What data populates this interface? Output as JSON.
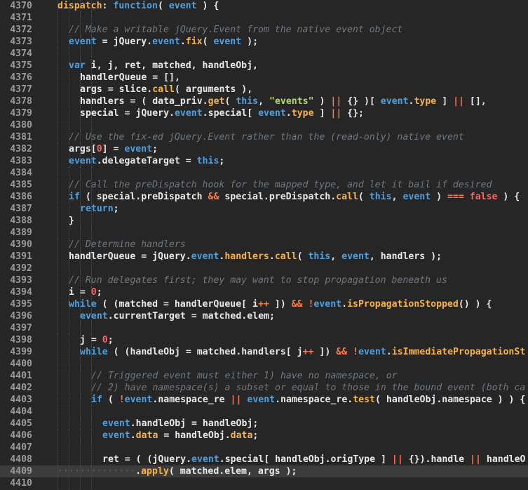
{
  "editor": {
    "active_line": 4409,
    "colors": {
      "background": "#262626",
      "active_line": "#3c3c3c",
      "keyword": "#4fa0e0",
      "function": "#f6b347",
      "comment": "#6f7880",
      "string": "#b5d96a",
      "number": "#ff6060",
      "operator": "#ff7a4a"
    },
    "lines": [
      {
        "n": "4370",
        "indent": 0,
        "tokens": [
          [
            "fn",
            "dispatch"
          ],
          [
            "pl",
            ": "
          ],
          [
            "kw",
            "function"
          ],
          [
            "pl",
            "( "
          ],
          [
            "kw",
            "event"
          ],
          [
            "pl",
            " ) {"
          ]
        ]
      },
      {
        "n": "4371",
        "indent": 0,
        "tokens": []
      },
      {
        "n": "4372",
        "indent": 1,
        "tokens": [
          [
            "cm",
            "// Make a writable jQuery.Event from the native event object"
          ]
        ]
      },
      {
        "n": "4373",
        "indent": 1,
        "tokens": [
          [
            "kw",
            "event"
          ],
          [
            "pl",
            " = jQuery."
          ],
          [
            "kw",
            "event"
          ],
          [
            "pl",
            "."
          ],
          [
            "fn",
            "fix"
          ],
          [
            "pl",
            "( "
          ],
          [
            "kw",
            "event"
          ],
          [
            "pl",
            " );"
          ]
        ]
      },
      {
        "n": "4374",
        "indent": 0,
        "tokens": []
      },
      {
        "n": "4375",
        "indent": 1,
        "tokens": [
          [
            "kw",
            "var"
          ],
          [
            "pl",
            " i, j, ret, matched, handleObj,"
          ]
        ]
      },
      {
        "n": "4376",
        "indent": 2,
        "tokens": [
          [
            "pl",
            "handlerQueue = [],"
          ]
        ]
      },
      {
        "n": "4377",
        "indent": 2,
        "tokens": [
          [
            "pl",
            "args = slice."
          ],
          [
            "fn",
            "call"
          ],
          [
            "pl",
            "( arguments ),"
          ]
        ]
      },
      {
        "n": "4378",
        "indent": 2,
        "tokens": [
          [
            "pl",
            "handlers = ( data_priv."
          ],
          [
            "fn",
            "get"
          ],
          [
            "pl",
            "( "
          ],
          [
            "kw",
            "this"
          ],
          [
            "pl",
            ", "
          ],
          [
            "str",
            "\"events\""
          ],
          [
            "pl",
            " ) "
          ],
          [
            "op",
            "||"
          ],
          [
            "pl",
            " {} )[ "
          ],
          [
            "kw",
            "event"
          ],
          [
            "pl",
            "."
          ],
          [
            "prop",
            "type"
          ],
          [
            "pl",
            " ] "
          ],
          [
            "op",
            "||"
          ],
          [
            "pl",
            " [],"
          ]
        ]
      },
      {
        "n": "4379",
        "indent": 2,
        "tokens": [
          [
            "pl",
            "special = jQuery."
          ],
          [
            "kw",
            "event"
          ],
          [
            "pl",
            ".special[ "
          ],
          [
            "kw",
            "event"
          ],
          [
            "pl",
            "."
          ],
          [
            "prop",
            "type"
          ],
          [
            "pl",
            " ] "
          ],
          [
            "op",
            "||"
          ],
          [
            "pl",
            " {};"
          ]
        ]
      },
      {
        "n": "4380",
        "indent": 0,
        "tokens": []
      },
      {
        "n": "4381",
        "indent": 1,
        "tokens": [
          [
            "cm",
            "// Use the fix-ed jQuery.Event rather than the (read-only) native event"
          ]
        ]
      },
      {
        "n": "4382",
        "indent": 1,
        "tokens": [
          [
            "pl",
            "args["
          ],
          [
            "num",
            "0"
          ],
          [
            "pl",
            "] = "
          ],
          [
            "kw",
            "event"
          ],
          [
            "pl",
            ";"
          ]
        ]
      },
      {
        "n": "4383",
        "indent": 1,
        "tokens": [
          [
            "kw",
            "event"
          ],
          [
            "pl",
            ".delegateTarget = "
          ],
          [
            "kw",
            "this"
          ],
          [
            "pl",
            ";"
          ]
        ]
      },
      {
        "n": "4384",
        "indent": 0,
        "tokens": []
      },
      {
        "n": "4385",
        "indent": 1,
        "tokens": [
          [
            "cm",
            "// Call the preDispatch hook for the mapped type, and let it bail if desired"
          ]
        ]
      },
      {
        "n": "4386",
        "indent": 1,
        "tokens": [
          [
            "kw",
            "if"
          ],
          [
            "pl",
            " ( special.preDispatch "
          ],
          [
            "op",
            "&&"
          ],
          [
            "pl",
            " special.preDispatch."
          ],
          [
            "fn",
            "call"
          ],
          [
            "pl",
            "( "
          ],
          [
            "kw",
            "this"
          ],
          [
            "pl",
            ", "
          ],
          [
            "kw",
            "event"
          ],
          [
            "pl",
            " ) "
          ],
          [
            "op",
            "==="
          ],
          [
            "pl",
            " "
          ],
          [
            "num",
            "false"
          ],
          [
            "pl",
            " ) {"
          ]
        ]
      },
      {
        "n": "4387",
        "indent": 2,
        "tokens": [
          [
            "kw",
            "return"
          ],
          [
            "pl",
            ";"
          ]
        ]
      },
      {
        "n": "4388",
        "indent": 1,
        "tokens": [
          [
            "pl",
            "}"
          ]
        ]
      },
      {
        "n": "4389",
        "indent": 0,
        "tokens": []
      },
      {
        "n": "4390",
        "indent": 1,
        "tokens": [
          [
            "cm",
            "// Determine handlers"
          ]
        ]
      },
      {
        "n": "4391",
        "indent": 1,
        "tokens": [
          [
            "pl",
            "handlerQueue = jQuery."
          ],
          [
            "kw",
            "event"
          ],
          [
            "pl",
            "."
          ],
          [
            "fn",
            "handlers"
          ],
          [
            "pl",
            "."
          ],
          [
            "fn",
            "call"
          ],
          [
            "pl",
            "( "
          ],
          [
            "kw",
            "this"
          ],
          [
            "pl",
            ", "
          ],
          [
            "kw",
            "event"
          ],
          [
            "pl",
            ", handlers );"
          ]
        ]
      },
      {
        "n": "4392",
        "indent": 0,
        "tokens": []
      },
      {
        "n": "4393",
        "indent": 1,
        "tokens": [
          [
            "cm",
            "// Run delegates first; they may want to stop propagation beneath us"
          ]
        ]
      },
      {
        "n": "4394",
        "indent": 1,
        "tokens": [
          [
            "pl",
            "i = "
          ],
          [
            "num",
            "0"
          ],
          [
            "pl",
            ";"
          ]
        ]
      },
      {
        "n": "4395",
        "indent": 1,
        "tokens": [
          [
            "kw",
            "while"
          ],
          [
            "pl",
            " ( (matched = handlerQueue[ i"
          ],
          [
            "op",
            "++"
          ],
          [
            "pl",
            " ]) "
          ],
          [
            "op",
            "&&"
          ],
          [
            "pl",
            " "
          ],
          [
            "op",
            "!"
          ],
          [
            "kw",
            "event"
          ],
          [
            "pl",
            "."
          ],
          [
            "fn",
            "isPropagationStopped"
          ],
          [
            "pl",
            "() ) {"
          ]
        ]
      },
      {
        "n": "4396",
        "indent": 2,
        "tokens": [
          [
            "kw",
            "event"
          ],
          [
            "pl",
            ".currentTarget = matched.elem;"
          ]
        ]
      },
      {
        "n": "4397",
        "indent": 0,
        "tokens": []
      },
      {
        "n": "4398",
        "indent": 2,
        "tokens": [
          [
            "pl",
            "j = "
          ],
          [
            "num",
            "0"
          ],
          [
            "pl",
            ";"
          ]
        ]
      },
      {
        "n": "4399",
        "indent": 2,
        "tokens": [
          [
            "kw",
            "while"
          ],
          [
            "pl",
            " ( (handleObj = matched.handlers[ j"
          ],
          [
            "op",
            "++"
          ],
          [
            "pl",
            " ]) "
          ],
          [
            "op",
            "&&"
          ],
          [
            "pl",
            " "
          ],
          [
            "op",
            "!"
          ],
          [
            "kw",
            "event"
          ],
          [
            "pl",
            "."
          ],
          [
            "fn",
            "isImmediatePropagationSt"
          ]
        ]
      },
      {
        "n": "4400",
        "indent": 0,
        "tokens": []
      },
      {
        "n": "4401",
        "indent": 3,
        "tokens": [
          [
            "cm",
            "// Triggered event must either 1) have no namespace, or"
          ]
        ]
      },
      {
        "n": "4402",
        "indent": 3,
        "tokens": [
          [
            "cm",
            "// 2) have namespace(s) a subset or equal to those in the bound event (both ca"
          ]
        ]
      },
      {
        "n": "4403",
        "indent": 3,
        "tokens": [
          [
            "kw",
            "if"
          ],
          [
            "pl",
            " ( "
          ],
          [
            "op",
            "!"
          ],
          [
            "kw",
            "event"
          ],
          [
            "pl",
            ".namespace_re "
          ],
          [
            "op",
            "||"
          ],
          [
            "pl",
            " "
          ],
          [
            "kw",
            "event"
          ],
          [
            "pl",
            ".namespace_re."
          ],
          [
            "fn",
            "test"
          ],
          [
            "pl",
            "( handleObj.namespace ) ) {"
          ]
        ]
      },
      {
        "n": "4404",
        "indent": 0,
        "tokens": []
      },
      {
        "n": "4405",
        "indent": 4,
        "tokens": [
          [
            "kw",
            "event"
          ],
          [
            "pl",
            ".handleObj = handleObj;"
          ]
        ]
      },
      {
        "n": "4406",
        "indent": 4,
        "tokens": [
          [
            "kw",
            "event"
          ],
          [
            "pl",
            "."
          ],
          [
            "prop",
            "data"
          ],
          [
            "pl",
            " = handleObj."
          ],
          [
            "prop",
            "data"
          ],
          [
            "pl",
            ";"
          ]
        ]
      },
      {
        "n": "4407",
        "indent": 0,
        "tokens": []
      },
      {
        "n": "4408",
        "indent": 4,
        "tokens": [
          [
            "pl",
            "ret = ( (jQuery."
          ],
          [
            "kw",
            "event"
          ],
          [
            "pl",
            ".special[ handleObj.origType ] "
          ],
          [
            "op",
            "||"
          ],
          [
            "pl",
            " {}).handle "
          ],
          [
            "op",
            "||"
          ],
          [
            "pl",
            " handleO"
          ]
        ]
      },
      {
        "n": "4409",
        "indent": 0,
        "tokens": [
          [
            "ws",
            "··············"
          ],
          [
            "pl",
            "."
          ],
          [
            "fn",
            "apply"
          ],
          [
            "pl",
            "( matched.elem, args );"
          ]
        ]
      },
      {
        "n": "4410",
        "indent": 0,
        "tokens": []
      }
    ]
  }
}
